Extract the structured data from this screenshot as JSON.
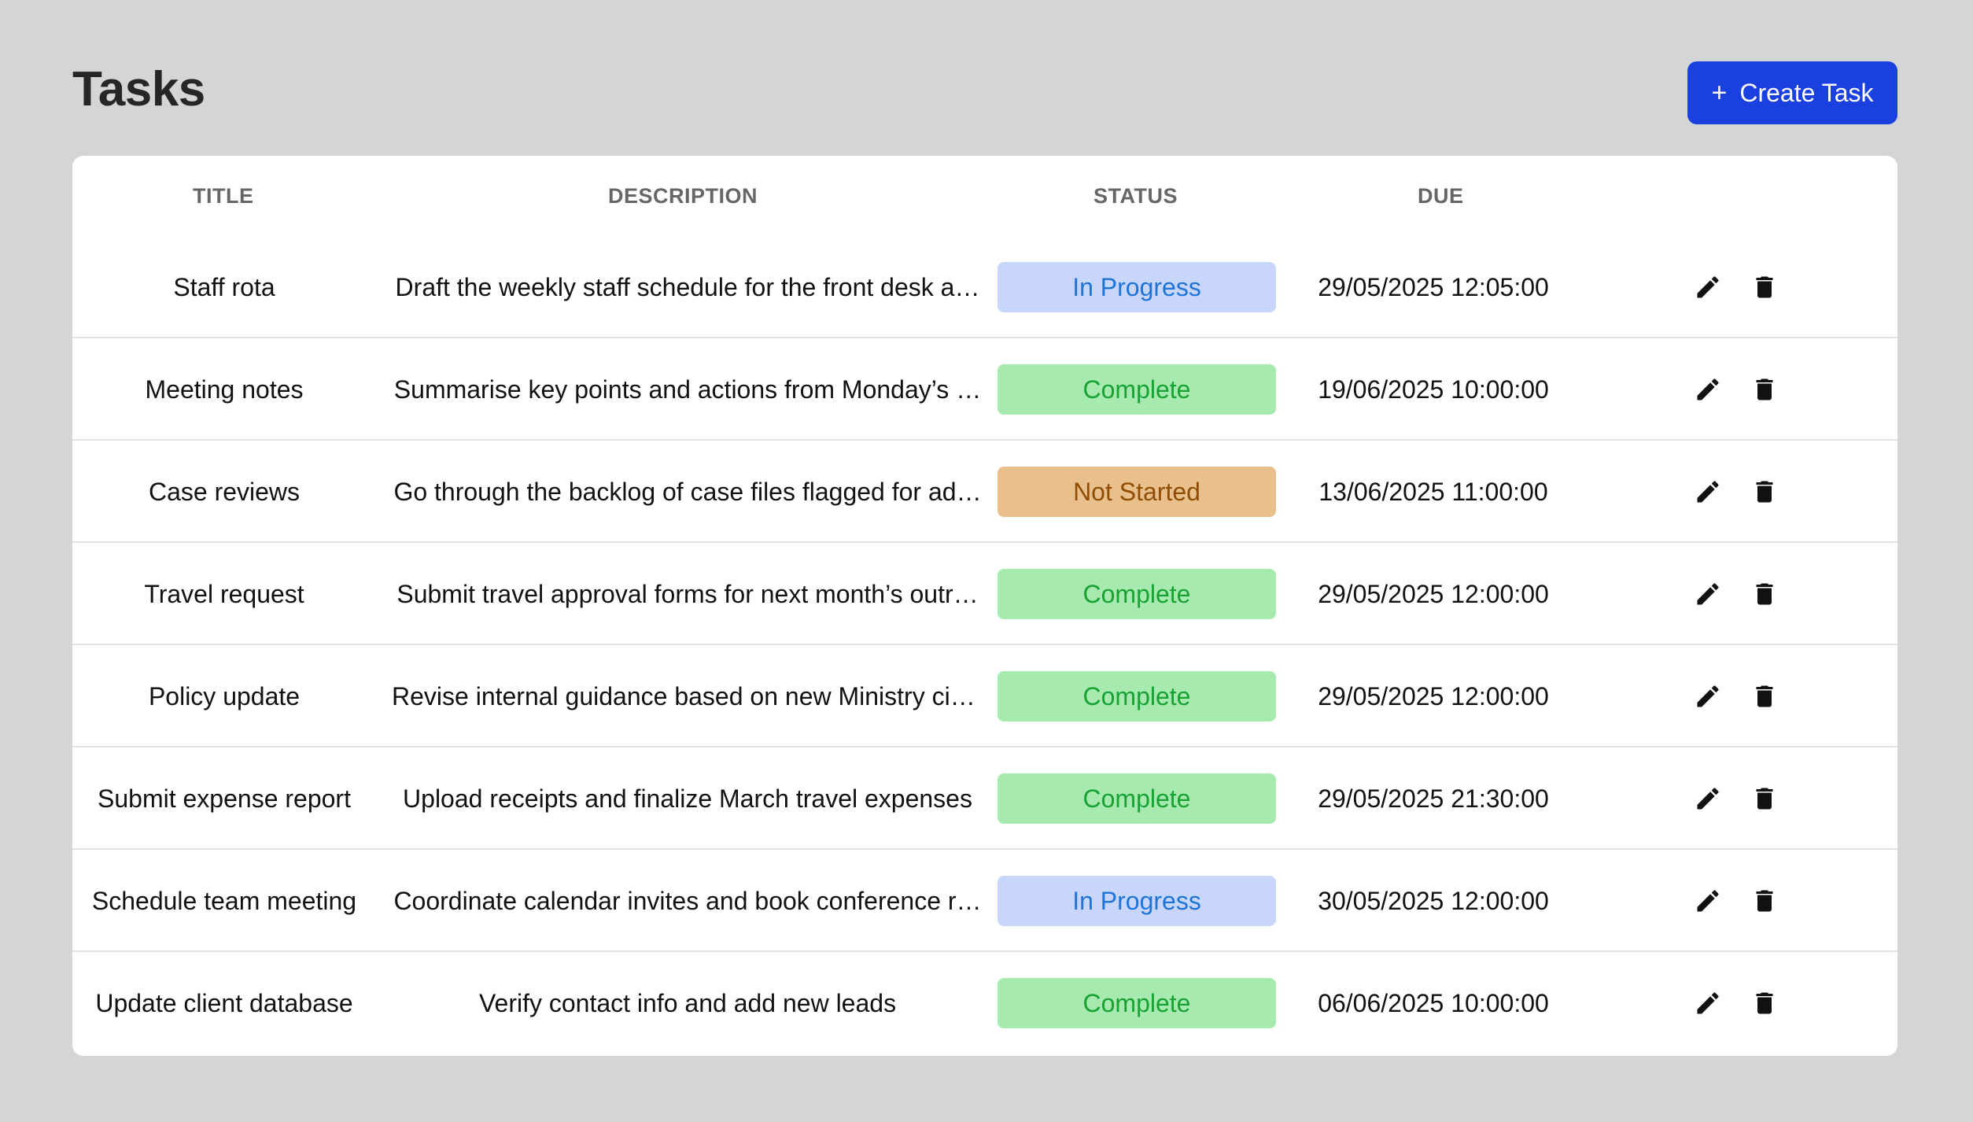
{
  "header": {
    "title": "Tasks",
    "create_button": {
      "icon": "plus-icon",
      "label": "Create Task",
      "color": "#1a40e0"
    }
  },
  "table": {
    "columns": [
      "TITLE",
      "DESCRIPTION",
      "STATUS",
      "DUE"
    ],
    "status_styles": {
      "In Progress": {
        "bg": "#c8d6fb",
        "fg": "#1f74d8"
      },
      "Complete": {
        "bg": "#a6eab0",
        "fg": "#18a234"
      },
      "Not Started": {
        "bg": "#e9c08b",
        "fg": "#8f4d06"
      }
    },
    "row_actions": [
      "pencil-icon",
      "trash-icon"
    ],
    "rows": [
      {
        "title": "Staff rota",
        "description": "Draft the weekly staff schedule for the front desk a…",
        "status": "In Progress",
        "due": "29/05/2025 12:05:00"
      },
      {
        "title": "Meeting notes",
        "description": "Summarise key points and actions from Monday’s …",
        "status": "Complete",
        "due": "19/06/2025 10:00:00"
      },
      {
        "title": "Case reviews",
        "description": "Go through the backlog of case files flagged for ad…",
        "status": "Not Started",
        "due": "13/06/2025 11:00:00"
      },
      {
        "title": "Travel request",
        "description": "Submit travel approval forms for next month’s outr…",
        "status": "Complete",
        "due": "29/05/2025 12:00:00"
      },
      {
        "title": "Policy update",
        "description": "Revise internal guidance based on new Ministry cir…",
        "status": "Complete",
        "due": "29/05/2025 12:00:00"
      },
      {
        "title": "Submit expense report",
        "description": "Upload receipts and finalize March travel expenses",
        "status": "Complete",
        "due": "29/05/2025 21:30:00"
      },
      {
        "title": "Schedule team meeting",
        "description": "Coordinate calendar invites and book conference r…",
        "status": "In Progress",
        "due": "30/05/2025 12:00:00"
      },
      {
        "title": "Update client database",
        "description": "Verify contact info and add new leads",
        "status": "Complete",
        "due": "06/06/2025 10:00:00"
      }
    ]
  }
}
